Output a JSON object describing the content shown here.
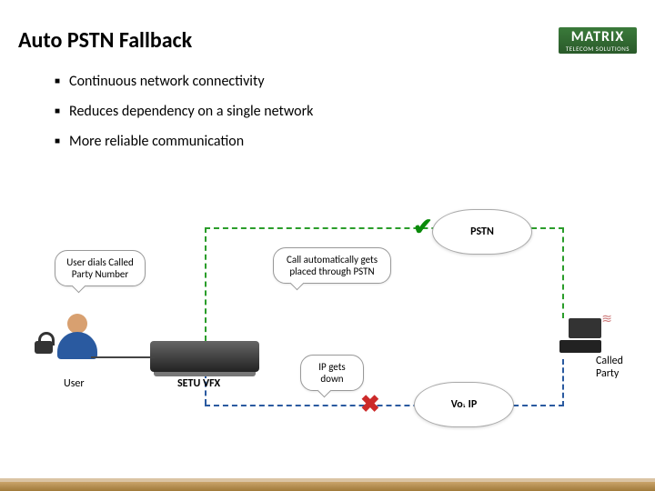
{
  "logo": {
    "brand": "MATRIX",
    "sub": "TELECOM SOLUTIONS"
  },
  "title": "Auto PSTN Fallback",
  "bullets": [
    "Continuous network connectivity",
    "Reduces dependency on a single network",
    "More reliable communication"
  ],
  "diagram": {
    "pstn_cloud": "PSTN",
    "voip_cloud": "Vo. IP",
    "speech_user": "User dials Called Party Number",
    "speech_auto": "Call automatically gets placed through PSTN",
    "speech_ipdown": "IP gets down",
    "user_label": "User",
    "device_label": "SETU VFX",
    "called_label": "Called Party"
  }
}
